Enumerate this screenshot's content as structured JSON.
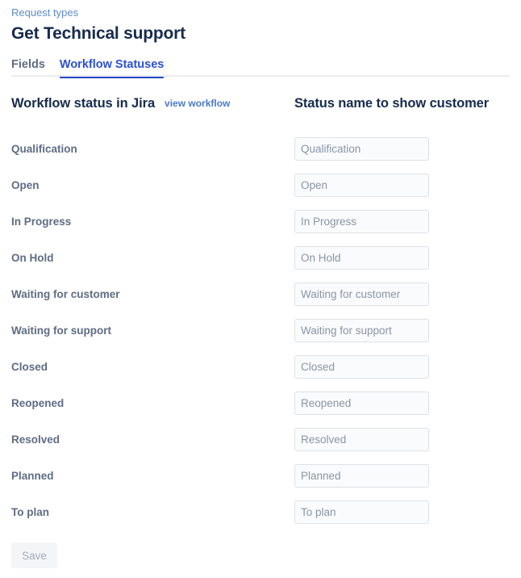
{
  "breadcrumb": {
    "label": "Request types"
  },
  "header": {
    "title": "Get Technical support"
  },
  "tabs": [
    {
      "label": "Fields",
      "active": false
    },
    {
      "label": "Workflow Statuses",
      "active": true
    }
  ],
  "table": {
    "col_left_header": "Workflow status in Jira",
    "view_workflow_link": "view workflow",
    "col_right_header": "Status name to show customer",
    "rows": [
      {
        "jira_status": "Qualification",
        "customer_name": "",
        "placeholder": "Qualification"
      },
      {
        "jira_status": "Open",
        "customer_name": "",
        "placeholder": "Open"
      },
      {
        "jira_status": "In Progress",
        "customer_name": "",
        "placeholder": "In Progress"
      },
      {
        "jira_status": "On Hold",
        "customer_name": "",
        "placeholder": "On Hold"
      },
      {
        "jira_status": "Waiting for customer",
        "customer_name": "",
        "placeholder": "Waiting for customer"
      },
      {
        "jira_status": "Waiting for support",
        "customer_name": "",
        "placeholder": "Waiting for support"
      },
      {
        "jira_status": "Closed",
        "customer_name": "",
        "placeholder": "Closed"
      },
      {
        "jira_status": "Reopened",
        "customer_name": "",
        "placeholder": "Reopened"
      },
      {
        "jira_status": "Resolved",
        "customer_name": "",
        "placeholder": "Resolved"
      },
      {
        "jira_status": "Planned",
        "customer_name": "",
        "placeholder": "Planned"
      },
      {
        "jira_status": "To plan",
        "customer_name": "",
        "placeholder": "To plan"
      }
    ]
  },
  "footer": {
    "save_label": "Save",
    "save_disabled": true
  },
  "colors": {
    "link": "#5E8BC6",
    "tab_active": "#2448C8",
    "title": "#172B4D",
    "label": "#5E6C84",
    "input_bg": "#FAFBFC",
    "input_border": "#DFE1E6",
    "divider": "#EBECF0",
    "save_bg": "#F4F5F7",
    "save_text": "#A5ADBA"
  }
}
